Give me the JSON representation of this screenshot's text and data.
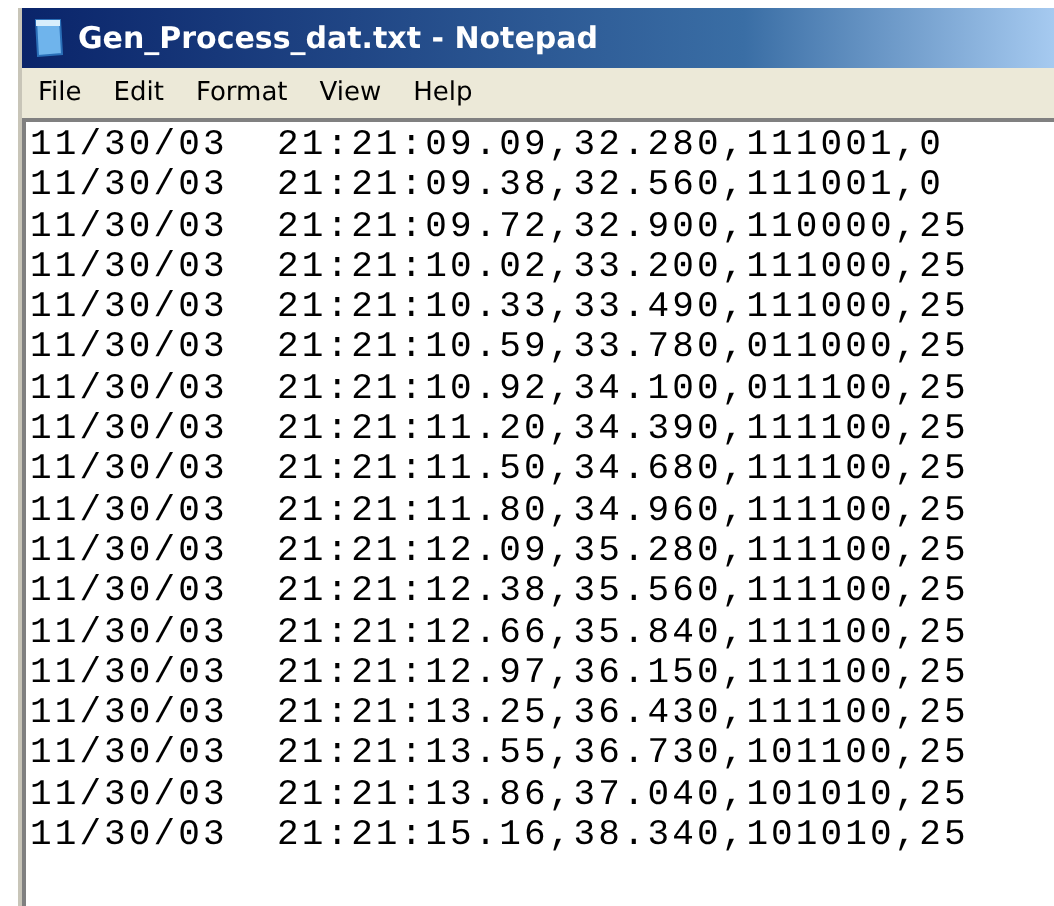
{
  "window": {
    "title": "Gen_Process_dat.txt - Notepad"
  },
  "menu": [
    "File",
    "Edit",
    "Format",
    "View",
    "Help"
  ],
  "lines": [
    "11/30/03  21:21:09.09,32.280,111001,0",
    "11/30/03  21:21:09.38,32.560,111001,0",
    "11/30/03  21:21:09.72,32.900,110000,25",
    "11/30/03  21:21:10.02,33.200,111000,25",
    "11/30/03  21:21:10.33,33.490,111000,25",
    "11/30/03  21:21:10.59,33.780,011000,25",
    "11/30/03  21:21:10.92,34.100,011100,25",
    "11/30/03  21:21:11.20,34.390,111100,25",
    "11/30/03  21:21:11.50,34.680,111100,25",
    "11/30/03  21:21:11.80,34.960,111100,25",
    "11/30/03  21:21:12.09,35.280,111100,25",
    "11/30/03  21:21:12.38,35.560,111100,25",
    "11/30/03  21:21:12.66,35.840,111100,25",
    "11/30/03  21:21:12.97,36.150,111100,25",
    "11/30/03  21:21:13.25,36.430,111100,25",
    "11/30/03  21:21:13.55,36.730,101100,25",
    "11/30/03  21:21:13.86,37.040,101010,25",
    "11/30/03  21:21:15.16,38.340,101010,25"
  ]
}
